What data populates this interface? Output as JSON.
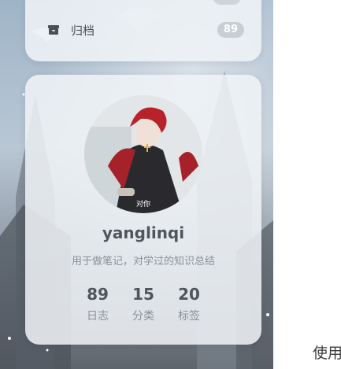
{
  "menu": {
    "archive": {
      "icon": "archive-icon",
      "label": "归档",
      "count": "89"
    }
  },
  "profile": {
    "avatar_caption": "对你",
    "username": "yanglinqi",
    "bio": "用于做笔记，对学过的知识总结",
    "stats": [
      {
        "value": "89",
        "label": "日志"
      },
      {
        "value": "15",
        "label": "分类"
      },
      {
        "value": "20",
        "label": "标签"
      }
    ]
  },
  "side_text": "使用"
}
